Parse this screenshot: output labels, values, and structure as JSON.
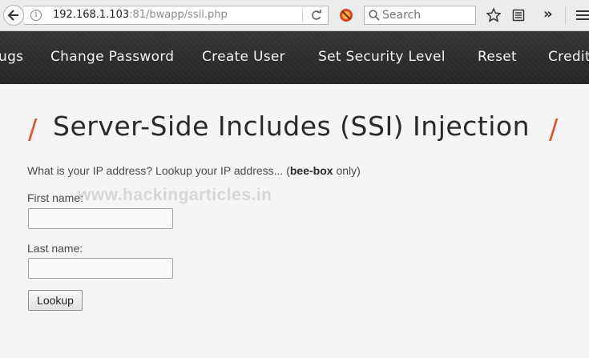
{
  "browser": {
    "url_host": "192.168.1.103",
    "url_rest": ":81/bwapp/ssii.php",
    "search_placeholder": "Search",
    "info_glyph": "i",
    "overflow_glyph": "»"
  },
  "nav": {
    "items": [
      {
        "label": "ugs"
      },
      {
        "label": "Change Password"
      },
      {
        "label": "Create User"
      },
      {
        "label": "Set Security Level"
      },
      {
        "label": "Reset"
      },
      {
        "label": "Credit"
      }
    ]
  },
  "page": {
    "slash": "/",
    "title": "Server-Side Includes (SSI) Injection",
    "intro_prefix": "What is your IP address? Lookup your IP address... (",
    "intro_bold": "bee-box",
    "intro_suffix": " only)",
    "watermark": "www.hackingarticles.in"
  },
  "form": {
    "first_name_label": "First name:",
    "first_name_value": "",
    "last_name_label": "Last name:",
    "last_name_value": "",
    "submit_label": "Lookup"
  },
  "colors": {
    "accent": "#e2542d",
    "nav_bg": "#2c2c2c",
    "page_bg": "#f5f5f5"
  }
}
